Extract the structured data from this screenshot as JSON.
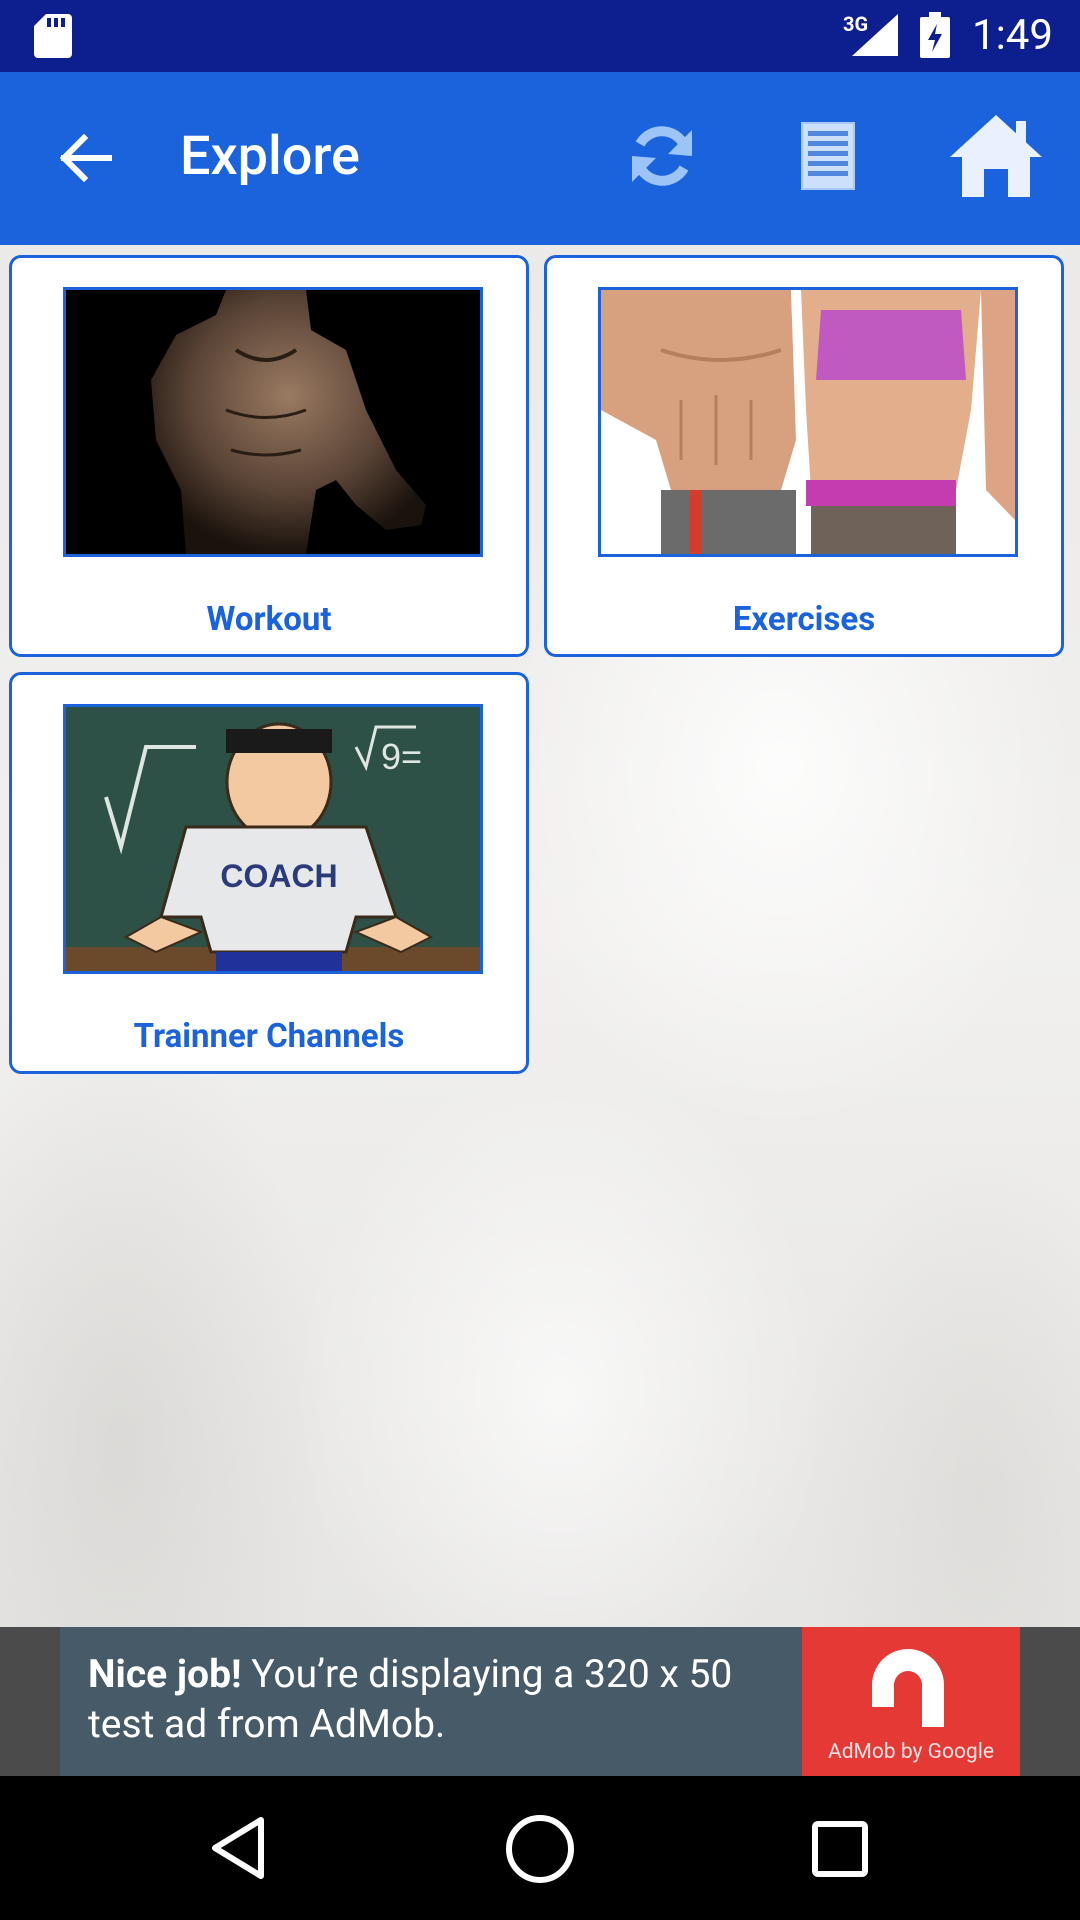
{
  "status_bar": {
    "time": "1:49",
    "network": "3G",
    "sd_icon": "sd-card-icon",
    "signal_icon": "signal-icon",
    "battery_icon": "battery-charging-icon"
  },
  "app_bar": {
    "title": "Explore",
    "back_icon": "arrow-back-icon",
    "refresh_icon": "refresh-icon",
    "list_icon": "list-icon",
    "home_icon": "home-icon",
    "color": "#1a63dc"
  },
  "cards": [
    {
      "label": "Workout"
    },
    {
      "label": "Exercises"
    },
    {
      "label": "Trainner Channels",
      "image_text": "COACH"
    }
  ],
  "ad": {
    "bold": "Nice job!",
    "line1_rest": " You’re displaying a 320 x 50",
    "line2": "test ad from AdMob.",
    "logo_caption": "AdMob by Google"
  },
  "nav_bar": {
    "back_icon": "triangle-back-icon",
    "home_icon": "circle-home-icon",
    "recent_icon": "square-recents-icon"
  }
}
